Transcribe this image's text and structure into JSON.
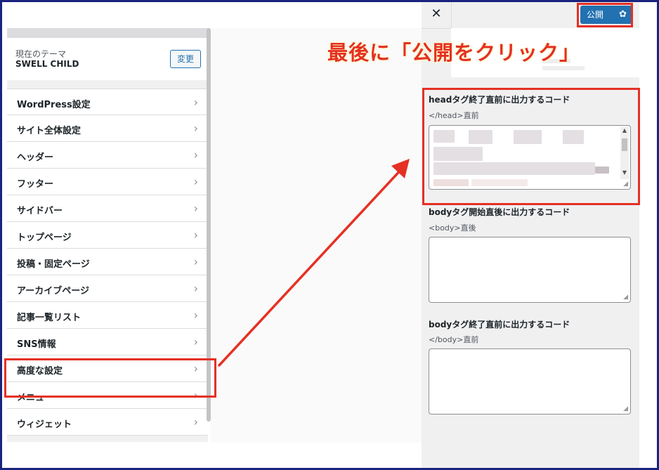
{
  "theme": {
    "label": "現在のテーマ",
    "name": "SWELL CHILD",
    "change_button": "変更"
  },
  "menu": {
    "items": [
      {
        "label": "WordPress設定"
      },
      {
        "label": "サイト全体設定"
      },
      {
        "label": "ヘッダー"
      },
      {
        "label": "フッター"
      },
      {
        "label": "サイドバー"
      },
      {
        "label": "トップページ"
      },
      {
        "label": "投稿・固定ページ"
      },
      {
        "label": "アーカイブページ"
      },
      {
        "label": "記事一覧リスト"
      },
      {
        "label": "SNS情報"
      },
      {
        "label": "高度な設定"
      },
      {
        "label": "メニュー"
      },
      {
        "label": "ウィジェット"
      }
    ],
    "arrow_glyph": "›",
    "highlighted_item": "高度な設定"
  },
  "header": {
    "close_glyph": "✕",
    "publish_label": "公開",
    "gear_glyph": "✿"
  },
  "sections": {
    "head": {
      "title": "headタグ終了直前に出力するコード",
      "sub": "</head>直前"
    },
    "body_start": {
      "title": "bodyタグ開始直後に出力するコード",
      "sub": "<body>直後"
    },
    "body_end": {
      "title": "bodyタグ終了直前に出力するコード",
      "sub": "</body>直前"
    }
  },
  "annotation": {
    "text": "最後に「公開をクリック」",
    "color": "#e53024"
  },
  "colors": {
    "accent": "#2271b1",
    "highlight": "#e53024",
    "frame": "#1a237e"
  }
}
